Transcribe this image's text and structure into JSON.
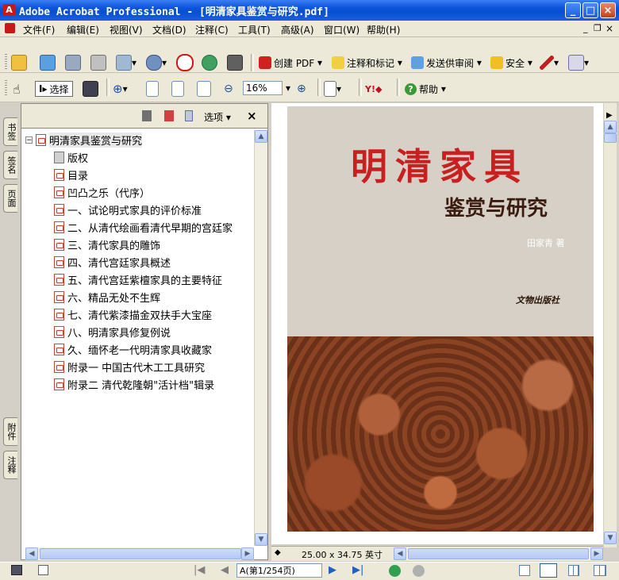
{
  "window": {
    "title": "Adobe Acrobat Professional - [明清家具鉴赏与研究.pdf]",
    "app_icon": "A"
  },
  "menu": {
    "items": [
      "文件(F)",
      "编辑(E)",
      "视图(V)",
      "文档(D)",
      "注释(C)",
      "工具(T)",
      "高级(A)",
      "窗口(W)",
      "帮助(H)"
    ]
  },
  "toolbar1": {
    "create_pdf": "创建 PDF",
    "comment_markup": "注释和标记",
    "send_review": "发送供审阅",
    "security": "安全"
  },
  "toolbar2": {
    "select": "选择",
    "zoom_value": "16%",
    "help": "帮助"
  },
  "side_tabs": {
    "bookmarks": "书签",
    "signatures": "签名",
    "pages": "页面",
    "attachments": "附件",
    "comments": "注释"
  },
  "nav": {
    "options": "选项",
    "close": "×",
    "root": "明清家具鉴赏与研究",
    "items": [
      "版权",
      "目录",
      "凹凸之乐（代序）",
      "一、试论明式家具的评价标准",
      "二、从清代绘画看清代早期的宫廷家",
      "三、清代家具的雕饰",
      "四、清代宫廷家具概述",
      "五、清代宫廷紫檀家具的主要特征",
      "六、精品无处不生辉",
      "七、清代紫漆描金双扶手大宝座",
      "八、明清家具修复例说",
      "久、缅怀老一代明清家具收藏家",
      "附录一  中国古代木工工具研究",
      "附录二 清代乾隆朝\"活计档\"辑录"
    ]
  },
  "cover": {
    "title": "明清家具",
    "subtitle": "鉴赏与研究",
    "author": "田家青 著",
    "publisher": "文物出版社"
  },
  "doc": {
    "page_size": "25.00 x 34.75 英寸"
  },
  "status": {
    "page_indicator": "A(第1/254页)"
  },
  "colors": {
    "title_bar": "#0a52d9",
    "cover_bg": "#5a2a14",
    "title_red": "#c82020",
    "subtitle_dark": "#3a1c10"
  }
}
